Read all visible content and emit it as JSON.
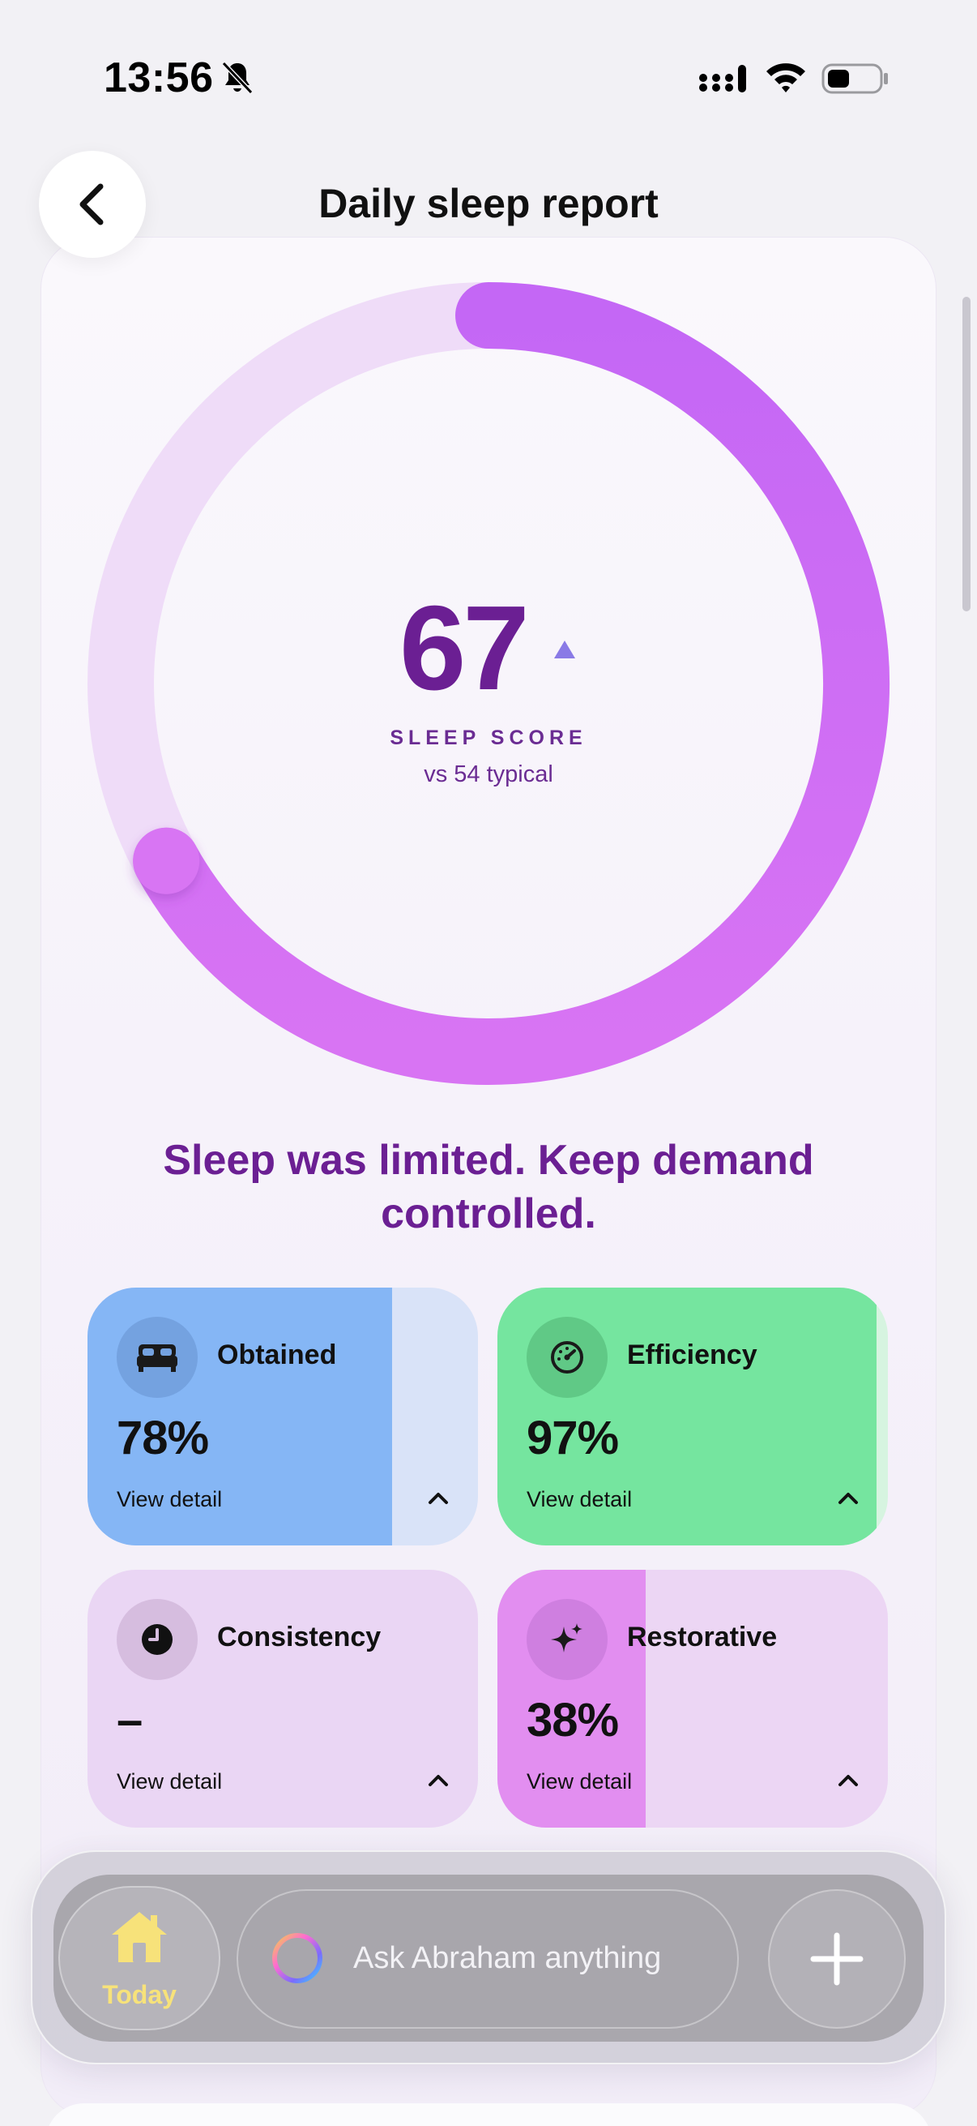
{
  "status_bar": {
    "time": "13:56",
    "icons": [
      "bell-off-icon",
      "signal-icon",
      "wifi-icon",
      "battery-icon"
    ]
  },
  "header": {
    "title": "Daily sleep report",
    "back_icon": "chevron-left-icon"
  },
  "score": {
    "value": "67",
    "label": "SLEEP SCORE",
    "comparison": "vs 54 typical",
    "fraction": 0.67,
    "trend": "up"
  },
  "headline": "Sleep was limited. Keep demand controlled.",
  "metrics": [
    {
      "title": "Obtained",
      "value": "78%",
      "link": "View detail",
      "icon": "bed-icon",
      "fraction": 0.78
    },
    {
      "title": "Efficiency",
      "value": "97%",
      "link": "View detail",
      "icon": "gauge-icon",
      "fraction": 0.97
    },
    {
      "title": "Consistency",
      "value": "–",
      "link": "View detail",
      "icon": "clock-icon",
      "fraction": 0
    },
    {
      "title": "Restorative",
      "value": "38%",
      "link": "View detail",
      "icon": "sparkle-icon",
      "fraction": 0.38
    }
  ],
  "bottom_bar": {
    "today_label": "Today",
    "ask_placeholder": "Ask Abraham anything",
    "add_icon": "plus-icon"
  },
  "colors": {
    "accent": "#d070f5",
    "accent_dark": "#6b1f93",
    "ring_track": "#efdcf8",
    "obtained": "#85b6f5",
    "efficiency": "#75e59f",
    "restorative": "#e28ef0",
    "today": "#f7e27a"
  }
}
